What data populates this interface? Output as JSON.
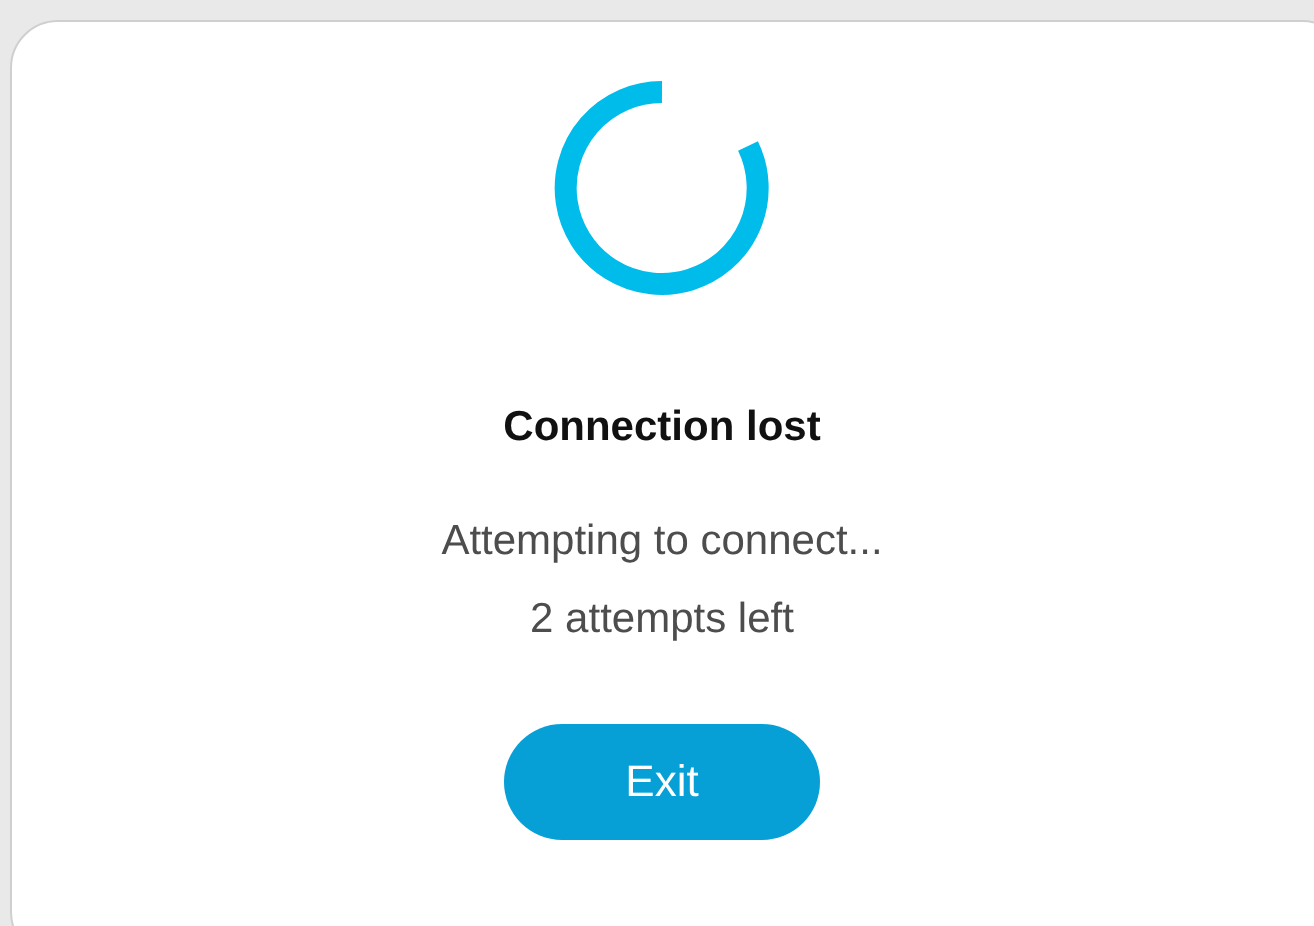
{
  "dialog": {
    "title": "Connection lost",
    "message": [
      "Attempting to connect...",
      "2 attempts left"
    ],
    "buttons": [
      "Exit"
    ]
  }
}
